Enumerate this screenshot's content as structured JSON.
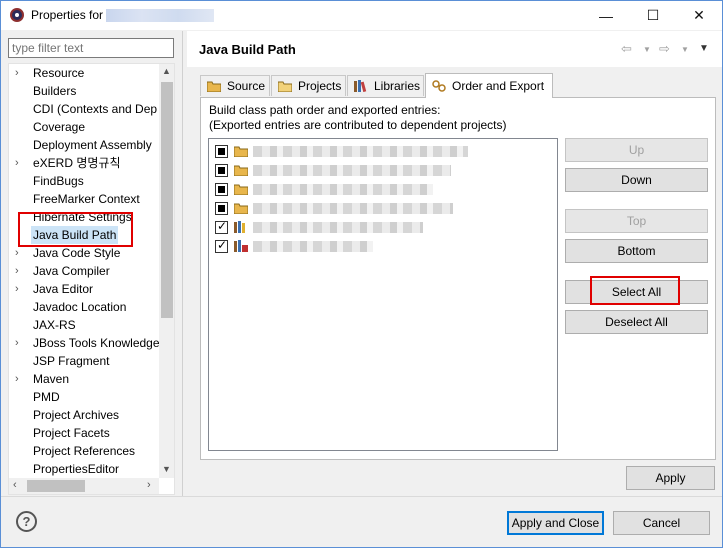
{
  "window": {
    "title": "Properties for",
    "minimize": "—",
    "maximize": "☐",
    "close": "✕"
  },
  "filter": {
    "placeholder": "type filter text",
    "value": ""
  },
  "tree": {
    "items": [
      {
        "label": "Resource",
        "expandable": true
      },
      {
        "label": "Builders",
        "expandable": false
      },
      {
        "label": "CDI (Contexts and Dep",
        "expandable": false
      },
      {
        "label": "Coverage",
        "expandable": false
      },
      {
        "label": "Deployment Assembly",
        "expandable": false
      },
      {
        "label": "eXERD 명명규칙",
        "expandable": true
      },
      {
        "label": "FindBugs",
        "expandable": false
      },
      {
        "label": "FreeMarker Context",
        "expandable": false
      },
      {
        "label": "Hibernate Settings",
        "expandable": false
      },
      {
        "label": "Java Build Path",
        "expandable": false,
        "selected": true
      },
      {
        "label": "Java Code Style",
        "expandable": true
      },
      {
        "label": "Java Compiler",
        "expandable": true
      },
      {
        "label": "Java Editor",
        "expandable": true
      },
      {
        "label": "Javadoc Location",
        "expandable": false
      },
      {
        "label": "JAX-RS",
        "expandable": false
      },
      {
        "label": "JBoss Tools Knowledge",
        "expandable": true
      },
      {
        "label": "JSP Fragment",
        "expandable": false
      },
      {
        "label": "Maven",
        "expandable": true
      },
      {
        "label": "PMD",
        "expandable": false
      },
      {
        "label": "Project Archives",
        "expandable": false
      },
      {
        "label": "Project Facets",
        "expandable": false
      },
      {
        "label": "Project References",
        "expandable": false
      },
      {
        "label": "PropertiesEditor",
        "expandable": false
      }
    ]
  },
  "page": {
    "title": "Java Build Path",
    "back_icon": "⇦",
    "forward_icon": "⇨",
    "menu_icon": "▼"
  },
  "tabs": [
    {
      "label": "Source",
      "icon": "folder-source-icon"
    },
    {
      "label": "Projects",
      "icon": "folder-project-icon"
    },
    {
      "label": "Libraries",
      "icon": "library-icon"
    },
    {
      "label": "Order and Export",
      "icon": "order-export-icon",
      "active": true
    }
  ],
  "order_export": {
    "description_line1": "Build class path order and exported entries:",
    "description_line2": "(Exported entries are contributed to dependent projects)",
    "entries": [
      {
        "state": "partial",
        "icon": "source-folder-icon"
      },
      {
        "state": "partial",
        "icon": "source-folder-icon"
      },
      {
        "state": "partial",
        "icon": "source-folder-icon"
      },
      {
        "state": "partial",
        "icon": "source-folder-icon"
      },
      {
        "state": "checked",
        "icon": "library-icon"
      },
      {
        "state": "checked",
        "icon": "server-library-icon"
      }
    ],
    "buttons": {
      "up": "Up",
      "down": "Down",
      "top": "Top",
      "bottom": "Bottom",
      "select_all": "Select All",
      "deselect_all": "Deselect All"
    }
  },
  "footer": {
    "apply": "Apply",
    "apply_and_close": "Apply and Close",
    "cancel": "Cancel",
    "help": "?"
  }
}
